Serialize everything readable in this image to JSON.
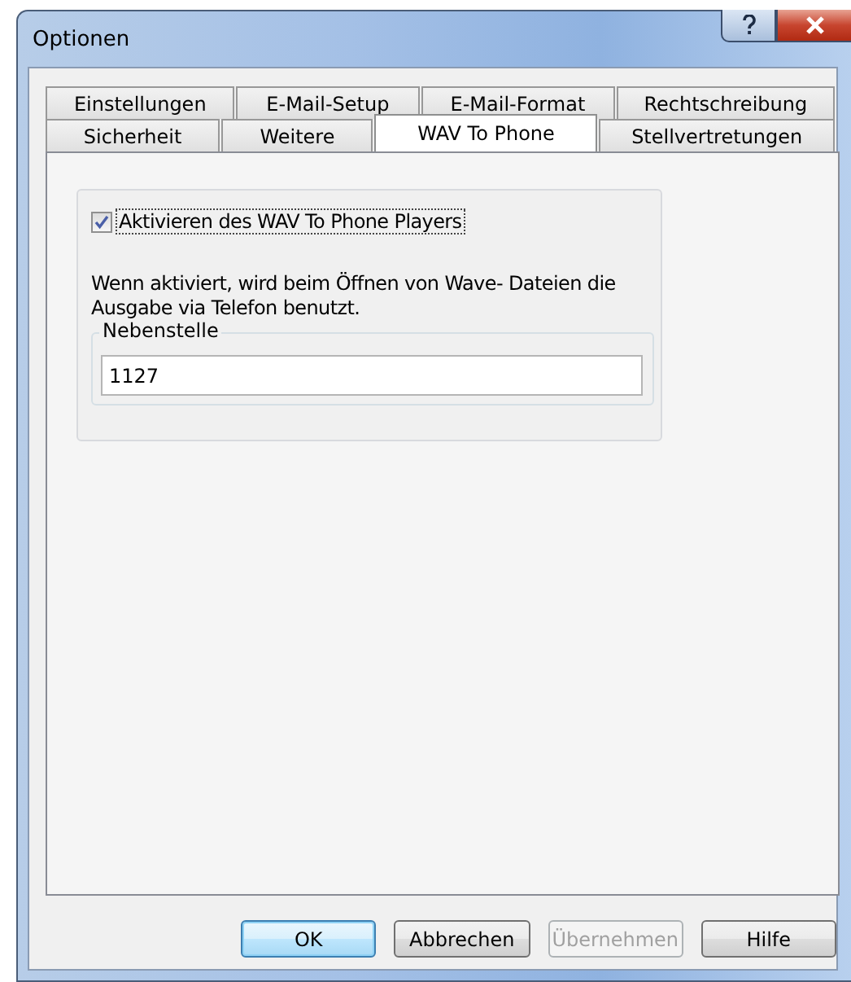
{
  "window": {
    "title": "Optionen"
  },
  "tab_rows": [
    [
      {
        "label": "Einstellungen",
        "selected": false
      },
      {
        "label": "E-Mail-Setup",
        "selected": false
      },
      {
        "label": "E-Mail-Format",
        "selected": false
      },
      {
        "label": "Rechtschreibung",
        "selected": false
      }
    ],
    [
      {
        "label": "Sicherheit",
        "selected": false
      },
      {
        "label": "Weitere",
        "selected": false
      },
      {
        "label": "WAV To Phone",
        "selected": true
      },
      {
        "label": "Stellvertretungen",
        "selected": false
      }
    ]
  ],
  "checkbox": {
    "label": "Aktivieren des WAV To Phone Players",
    "checked": true
  },
  "description": "Wenn aktiviert, wird beim Öffnen von Wave- Dateien die Ausgabe via Telefon benutzt.",
  "extension": {
    "label": "Nebenstelle",
    "value": "1127"
  },
  "buttons": [
    {
      "label": "OK",
      "default": true,
      "disabled": false
    },
    {
      "label": "Abbrechen",
      "default": false,
      "disabled": false
    },
    {
      "label": "Übernehmen",
      "default": false,
      "disabled": true
    },
    {
      "label": "Hilfe",
      "default": false,
      "disabled": false
    }
  ]
}
